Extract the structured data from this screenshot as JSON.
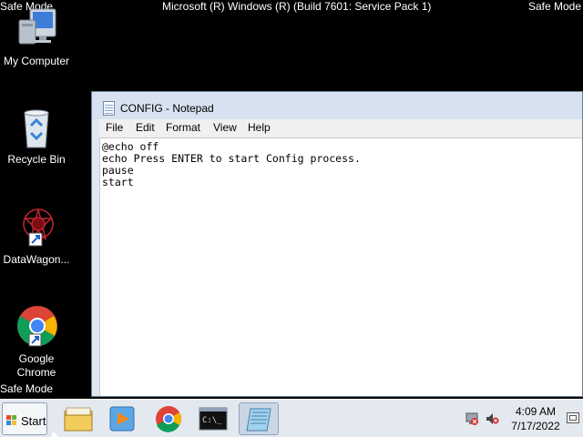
{
  "screen": {
    "safe_mode_top_left": "Safe Mode",
    "safe_mode_top_right": "Safe Mode",
    "safe_mode_bottom_left": "Safe Mode",
    "build_text": "Microsoft (R) Windows (R) (Build 7601: Service Pack 1)"
  },
  "desktop": {
    "icons": [
      {
        "label": "My Computer",
        "icon": "computer-icon"
      },
      {
        "label": "Recycle Bin",
        "icon": "recycle-bin-icon"
      },
      {
        "label": "DataWagon...",
        "icon": "datawagon-shortcut-icon"
      },
      {
        "label": "Google Chrome",
        "icon": "chrome-shortcut-icon"
      }
    ]
  },
  "notepad": {
    "title": "CONFIG - Notepad",
    "menu": [
      "File",
      "Edit",
      "Format",
      "View",
      "Help"
    ],
    "lines": [
      "@echo off",
      "echo Press ENTER to start Config process.",
      "pause",
      "start"
    ]
  },
  "taskbar": {
    "start_label": "Start",
    "buttons": [
      "explorer-icon",
      "media-player-icon",
      "chrome-icon",
      "cmd-icon",
      "notepad-icon"
    ],
    "active_button": "notepad-icon",
    "clock": {
      "time": "4:09 AM",
      "date": "7/17/2022"
    }
  },
  "colors": {
    "desktop_bg": "#000000",
    "taskbar_bg": "#e4e9ef",
    "window_frame": "#dfe8f2"
  }
}
